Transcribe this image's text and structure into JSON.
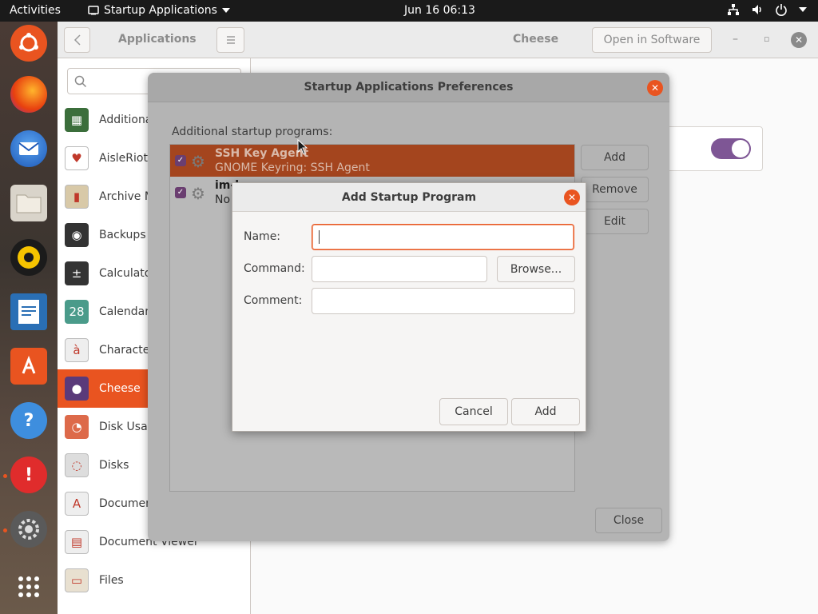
{
  "topbar": {
    "activities": "Activities",
    "app_menu": "Startup Applications",
    "clock": "Jun 16  06:13"
  },
  "dock": {
    "items": [
      "ubuntu-icon",
      "firefox-icon",
      "thunderbird-icon",
      "files-icon",
      "rhythmbox-icon",
      "writer-icon",
      "software-icon",
      "help-icon",
      "error-icon",
      "settings-icon",
      "show-apps-icon"
    ]
  },
  "software": {
    "header_title": "Applications",
    "detail_title": "Cheese",
    "open_button": "Open in Software",
    "apps": [
      {
        "label": "Additiona",
        "icon": "chip-icon",
        "color": "#3b6e3b"
      },
      {
        "label": "AisleRiot",
        "icon": "card-icon",
        "color": "#ffffff"
      },
      {
        "label": "Archive M",
        "icon": "archive-icon",
        "color": "#d8c9a8"
      },
      {
        "label": "Backups",
        "icon": "backup-icon",
        "color": "#333333"
      },
      {
        "label": "Calculato",
        "icon": "calculator-icon",
        "color": "#333333"
      },
      {
        "label": "Calendar",
        "icon": "calendar-icon",
        "color": "#4a9b8a"
      },
      {
        "label": "Character",
        "icon": "character-icon",
        "color": "#eeeeee"
      },
      {
        "label": "Cheese",
        "icon": "cheese-icon",
        "color": "#5a3a7a"
      },
      {
        "label": "Disk Usag",
        "icon": "disk-usage-icon",
        "color": "#dd6a4a"
      },
      {
        "label": "Disks",
        "icon": "disks-icon",
        "color": "#dddddd"
      },
      {
        "label": "Documen",
        "icon": "document-icon",
        "color": "#eeeeee"
      },
      {
        "label": "Document Viewer",
        "icon": "document-viewer-icon",
        "color": "#eeeeee"
      },
      {
        "label": "Files",
        "icon": "files-icon",
        "color": "#e8e0d0"
      }
    ]
  },
  "prefs": {
    "title": "Startup Applications Preferences",
    "list_label": "Additional startup programs:",
    "rows": [
      {
        "title": "SSH Key Agent",
        "subtitle": "GNOME Keyring: SSH Agent"
      },
      {
        "title": "im-l",
        "subtitle": "No"
      }
    ],
    "add": "Add",
    "remove": "Remove",
    "edit": "Edit",
    "close": "Close"
  },
  "add_dialog": {
    "title": "Add Startup Program",
    "name_label": "Name:",
    "command_label": "Command:",
    "comment_label": "Comment:",
    "name_value": "",
    "command_value": "",
    "comment_value": "",
    "browse": "Browse...",
    "cancel": "Cancel",
    "add": "Add"
  },
  "colors": {
    "accent": "#e95420",
    "selection": "#a4451e",
    "toggle_on": "#7e5695"
  }
}
